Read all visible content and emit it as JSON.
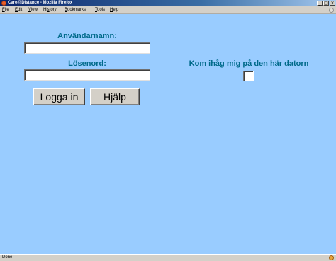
{
  "window": {
    "title": "Care@Distance - Mozilla Firefox",
    "controls": {
      "minimize": "_",
      "maximize": "□",
      "close": "×"
    }
  },
  "menubar": {
    "items": [
      {
        "label": "File",
        "mnemonic": "F",
        "rest": "ile"
      },
      {
        "label": "Edit",
        "mnemonic": "E",
        "rest": "dit"
      },
      {
        "label": "View",
        "mnemonic": "V",
        "rest": "iew"
      },
      {
        "label": "History",
        "mnemonic": "s",
        "pre": "Hi",
        "rest": "tory"
      },
      {
        "label": "Bookmarks",
        "mnemonic": "B",
        "rest": "ookmarks"
      },
      {
        "label": "Tools",
        "mnemonic": "T",
        "rest": "ools"
      },
      {
        "label": "Help",
        "mnemonic": "H",
        "rest": "elp"
      }
    ]
  },
  "login": {
    "username_label": "Användarnamn:",
    "username_value": "",
    "password_label": "Lösenord:",
    "password_value": "",
    "login_button": "Logga in",
    "help_button": "Hjälp",
    "remember_label": "Kom ihåg mig på den här datorn",
    "remember_checked": false
  },
  "status": {
    "text": "Done"
  },
  "colors": {
    "page_background": "#99ccff",
    "label_color": "#006a8a"
  }
}
